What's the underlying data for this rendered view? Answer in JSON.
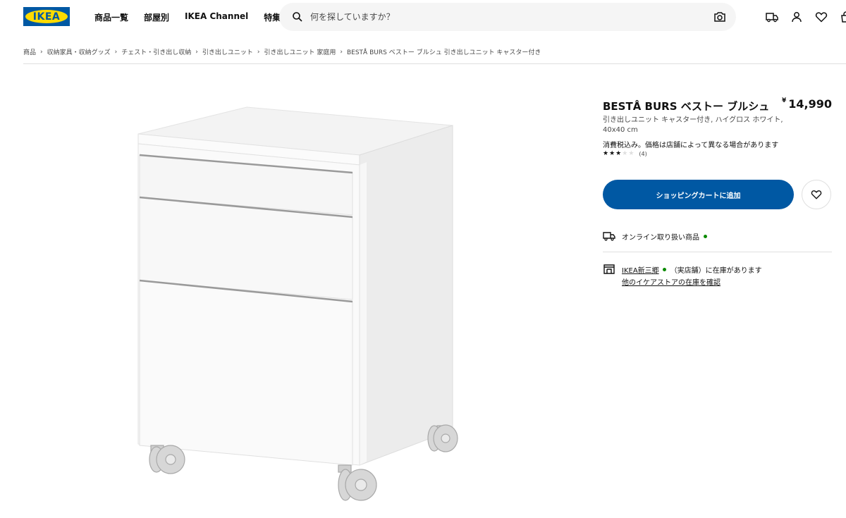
{
  "header": {
    "logo_text": "IKEA",
    "nav": [
      "商品一覧",
      "部屋別",
      "IKEA Channel",
      "特集"
    ],
    "search_placeholder": "何を探していますか？",
    "icons": [
      "delivery-truck-icon",
      "user-icon",
      "heart-icon",
      "shopping-bag-icon"
    ]
  },
  "breadcrumb": [
    "商品",
    "収納家具・収納グッズ",
    "チェスト・引き出し収納",
    "引き出しユニット",
    "引き出しユニット 家庭用",
    "BESTÅ BURS ベストー ブルシュ 引き出しユニット キャスター付き"
  ],
  "product": {
    "name": "BESTÅ BURS ベストー ブルシュ",
    "currency": "¥",
    "price": "14,990",
    "description": "引き出しユニット キャスター付き, ハイグロス ホワイト, 40x40 cm",
    "tax_note": "消費税込み。価格は店舗によって異なる場合があります",
    "rating": 3,
    "rating_max": 5,
    "review_count": "(4)",
    "cart_button": "ショッピングカートに追加",
    "online_label": "オンライン取り扱い商品",
    "store_name": "IKEA新三郷",
    "store_status": "（実店舗）に在庫があります",
    "other_stores_link": "他のイケアストアの在庫を確認"
  },
  "colors": {
    "brand_blue": "#0058a3",
    "brand_yellow": "#ffdb00",
    "stock_green": "#0a8a00"
  }
}
